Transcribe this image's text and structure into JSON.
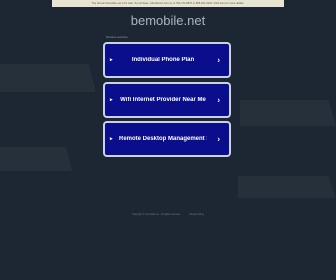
{
  "banner": {
    "text": "The domain bemobile.net is for sale. To purchase, call Afternic.com at +1 781-373-6847 or 855-201-0294. Click here for more details."
  },
  "header": {
    "domain": "bemobile.net"
  },
  "related": {
    "heading": "Related searches",
    "items": [
      {
        "label": "Individual Phone Plan"
      },
      {
        "label": "Wifi Internet Provider Near Me"
      },
      {
        "label": "Remote Desktop Management So..."
      }
    ]
  },
  "footer": {
    "copyright": "Copyright © bemobile.net . All rights reserved.",
    "privacy": "Privacy Policy"
  },
  "colors": {
    "background": "#1c2733",
    "button": "#0a0e8c",
    "button_border": "#c8d2e0",
    "banner": "#e8e4d2"
  }
}
